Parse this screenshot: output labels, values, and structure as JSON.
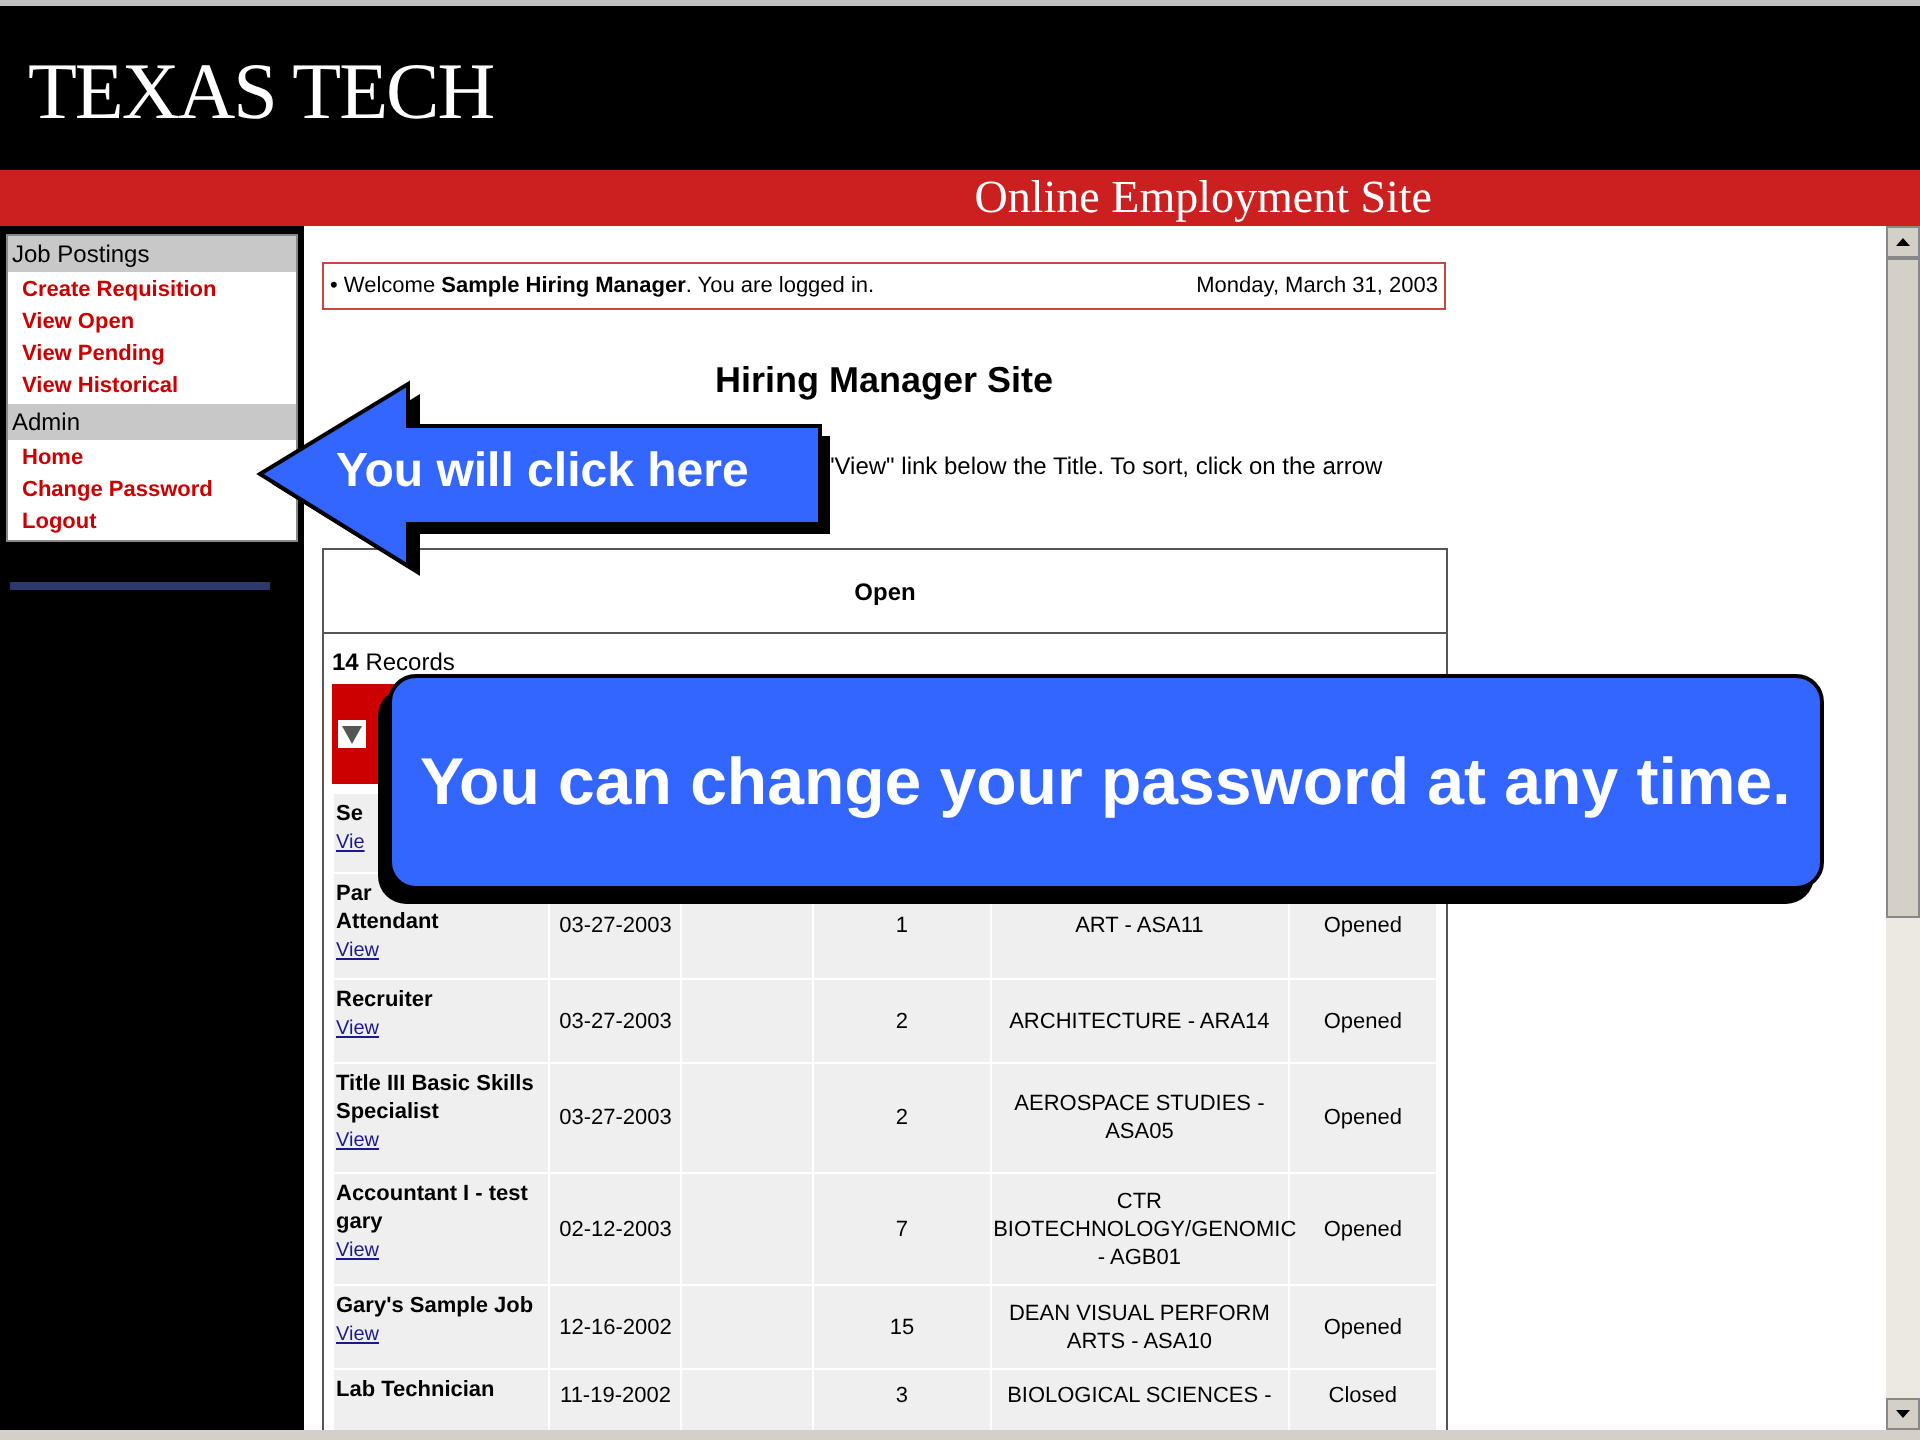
{
  "header": {
    "logo": "TEXAS TECH",
    "site_title": "Online Employment Site"
  },
  "sidebar": {
    "sections": [
      {
        "title": "Job Postings",
        "links": [
          "Create Requisition",
          "View Open",
          "View Pending",
          "View Historical"
        ]
      },
      {
        "title": "Admin",
        "links": [
          "Home",
          "Change Password",
          "Logout"
        ]
      }
    ]
  },
  "welcome": {
    "bullet": "•",
    "text": "Welcome **Sample Hiring Manager**. You are logged in.",
    "date": "Monday, March 31, 2003"
  },
  "page_title": "Hiring Manager Site",
  "instructions": "\"View\" link below the Title. To sort, click on the arrow",
  "table": {
    "title": "Open",
    "records": "**14** Records",
    "rows": [
      {
        "name_lines": [
          "Se"
        ],
        "link": "Vie"
      },
      {
        "name_lines": [
          "Par",
          "Attendant"
        ],
        "date": "03-27-2003",
        "count": "1",
        "department": "ART - ASA11",
        "status": "Opened",
        "link": "View"
      },
      {
        "name_lines": [
          "Recruiter"
        ],
        "date": "03-27-2003",
        "count": "2",
        "department": "ARCHITECTURE - ARA14",
        "status": "Opened",
        "link": "View"
      },
      {
        "name_lines": [
          "Title III Basic Skills",
          "Specialist"
        ],
        "date": "03-27-2003",
        "count": "2",
        "department": "AEROSPACE STUDIES - ASA05",
        "status": "Opened",
        "link": "View"
      },
      {
        "name_lines": [
          "Accountant I - test",
          "gary"
        ],
        "date": "02-12-2003",
        "count": "7",
        "department": "CTR BIOTECHNOLOGY/GENOMIC - AGB01",
        "status": "Opened",
        "link": "View"
      },
      {
        "name_lines": [
          "Gary's Sample Job"
        ],
        "date": "12-16-2002",
        "count": "15",
        "department": "DEAN VISUAL PERFORM ARTS - ASA10",
        "status": "Opened",
        "link": "View"
      },
      {
        "name_lines": [
          "Lab Technician"
        ],
        "date": "11-19-2002",
        "count": "3",
        "department": "BIOLOGICAL SCIENCES -",
        "status": "Closed"
      }
    ]
  },
  "callouts": [
    {
      "kind": "arrow",
      "text": "You will click here"
    },
    {
      "kind": "box",
      "text": "You can change your password at any time."
    }
  ]
}
